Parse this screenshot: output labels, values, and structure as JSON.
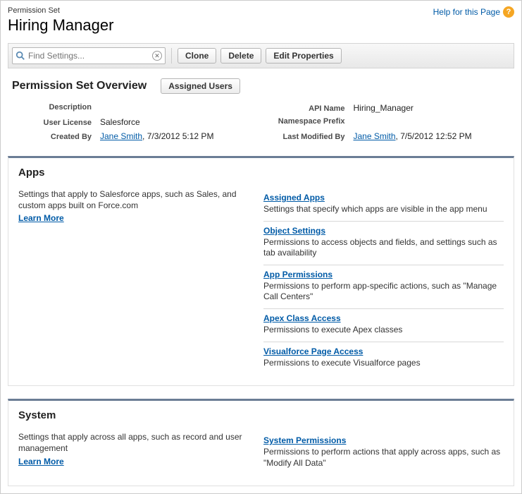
{
  "header": {
    "pre_title": "Permission Set",
    "title": "Hiring Manager",
    "help_text": "Help for this Page"
  },
  "toolbar": {
    "search_placeholder": "Find Settings...",
    "clone": "Clone",
    "delete": "Delete",
    "edit_properties": "Edit Properties"
  },
  "overview": {
    "title": "Permission Set Overview",
    "assigned_users": "Assigned Users",
    "labels": {
      "description": "Description",
      "api_name": "API Name",
      "user_license": "User License",
      "namespace_prefix": "Namespace Prefix",
      "created_by": "Created By",
      "last_modified_by": "Last Modified By"
    },
    "values": {
      "description": "",
      "api_name": "Hiring_Manager",
      "user_license": "Salesforce",
      "namespace_prefix": "",
      "created_by_user": "Jane Smith",
      "created_by_date": ", 7/3/2012 5:12 PM",
      "modified_by_user": "Jane Smith",
      "modified_by_date": ", 7/5/2012 12:52 PM"
    }
  },
  "apps": {
    "title": "Apps",
    "blurb": "Settings that apply to Salesforce apps, such as Sales, and custom apps built on Force.com",
    "learn_more": "Learn More",
    "items": [
      {
        "title": "Assigned Apps",
        "desc": "Settings that specify which apps are visible in the app menu"
      },
      {
        "title": "Object Settings",
        "desc": "Permissions to access objects and fields, and settings such as tab availability"
      },
      {
        "title": "App Permissions",
        "desc": "Permissions to perform app-specific actions, such as \"Manage Call Centers\""
      },
      {
        "title": "Apex Class Access",
        "desc": "Permissions to execute Apex classes"
      },
      {
        "title": "Visualforce Page Access",
        "desc": "Permissions to execute Visualforce pages"
      }
    ]
  },
  "system": {
    "title": "System",
    "blurb": "Settings that apply across all apps, such as record and user management",
    "learn_more": "Learn More",
    "items": [
      {
        "title": "System Permissions",
        "desc": "Permissions to perform actions that apply across apps, such as \"Modify All Data\""
      }
    ]
  }
}
